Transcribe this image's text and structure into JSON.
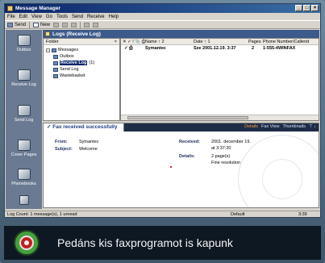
{
  "window": {
    "title": "Message Manager",
    "controls": [
      "_",
      "□",
      "×"
    ]
  },
  "menu": [
    "File",
    "Edit",
    "View",
    "Go",
    "Tools",
    "Send",
    "Receive",
    "Help"
  ],
  "toolbar": {
    "send": "Send",
    "new": "New"
  },
  "outlook_bar": [
    "Outbox",
    "Receive Log",
    "Send Log",
    "Cover Pages",
    "Phonebooks"
  ],
  "logs": {
    "header": "Logs (Receive Log)",
    "folder_pane": {
      "title": "Folder",
      "close": "×"
    },
    "tree": {
      "root": "Messages",
      "items": [
        "Outbox",
        "Receive Log",
        "Send Log",
        "Wastebasket"
      ],
      "selected_count": "(1)"
    },
    "columns": [
      "Name",
      "Date",
      "Pages",
      "Phone Number/Callerid"
    ],
    "column_sort": [
      "2",
      "1"
    ],
    "rows": [
      {
        "name": "Symantec",
        "date": "Sze 2001.12.19. 3:37",
        "pages": "2",
        "phone": "1-555-4WINFAX"
      }
    ]
  },
  "preview": {
    "title": "Fax received successfully",
    "tabs": [
      "Details",
      "Fax View",
      "Thumbnails"
    ],
    "from_label": "From:",
    "from": "Symantec",
    "subject_label": "Subject:",
    "subject": "Welcome",
    "received_label": "Received:",
    "received_date": "2001. december 19.",
    "received_time": "at 3:37:20",
    "details_label": "Details:",
    "details_pages": "2 page(s)",
    "details_res": "Fine resolution"
  },
  "status": {
    "count": "Log Count: 1 message(s), 1 unread",
    "profile": "Default",
    "time": "3:39"
  },
  "caption": "Pedáns kis faxprogramot is kapunk"
}
